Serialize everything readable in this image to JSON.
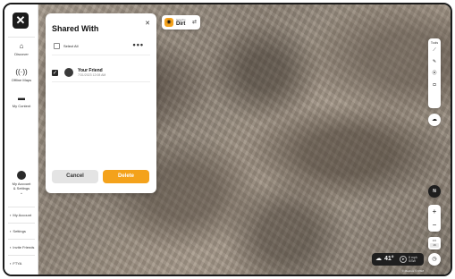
{
  "app": {
    "logo_glyph": "✕"
  },
  "sidebar": {
    "items": [
      {
        "label": "Discover",
        "icon": "binoculars-icon",
        "glyph": "⌂"
      },
      {
        "label": "Offline Maps",
        "icon": "offline-signal-icon",
        "glyph": "((·))"
      },
      {
        "label": "My Content",
        "icon": "folder-icon",
        "glyph": "▬"
      }
    ],
    "account": {
      "label_line1": "My Account",
      "label_line2": "& Settings",
      "chevron": "⌄"
    },
    "bottom_links": [
      {
        "label": "My Account",
        "icon": "user-icon"
      },
      {
        "label": "Settings",
        "icon": "gear-icon"
      },
      {
        "label": "Invite Friends",
        "icon": "invite-icon"
      },
      {
        "label": "FTYA",
        "icon": "help-icon"
      }
    ]
  },
  "panel": {
    "title": "Shared With",
    "close_glyph": "✕",
    "select_all_label": "Select All",
    "more_glyph": "•••",
    "friends": [
      {
        "name": "Your Friend",
        "date": "7/31/2023 12:08 AM",
        "checked": true
      }
    ],
    "cancel_label": "Cancel",
    "delete_label": "Delete",
    "accent_color": "#f4a21b"
  },
  "map_layer": {
    "sub_label": "Satellite",
    "name": "Dirt",
    "swap_glyph": "⇄"
  },
  "tools": {
    "label": "Tools",
    "items": [
      {
        "icon": "ruler-icon",
        "glyph": "⟋"
      },
      {
        "icon": "pen-icon",
        "glyph": "✎"
      },
      {
        "icon": "pin-icon",
        "glyph": "⦿"
      },
      {
        "icon": "camera-icon",
        "glyph": "◘"
      }
    ]
  },
  "layers_button_glyph": "☁",
  "compass_label": "N",
  "zoom": {
    "in": "+",
    "out": "−"
  },
  "scale": {
    "top": "0 ft",
    "value": "1ft"
  },
  "weather": {
    "temp": "41°",
    "wind_line1": "8 mph",
    "wind_line2": "SSW"
  },
  "clock_glyph": "◷",
  "attribution": "© Mapbox © OSM"
}
